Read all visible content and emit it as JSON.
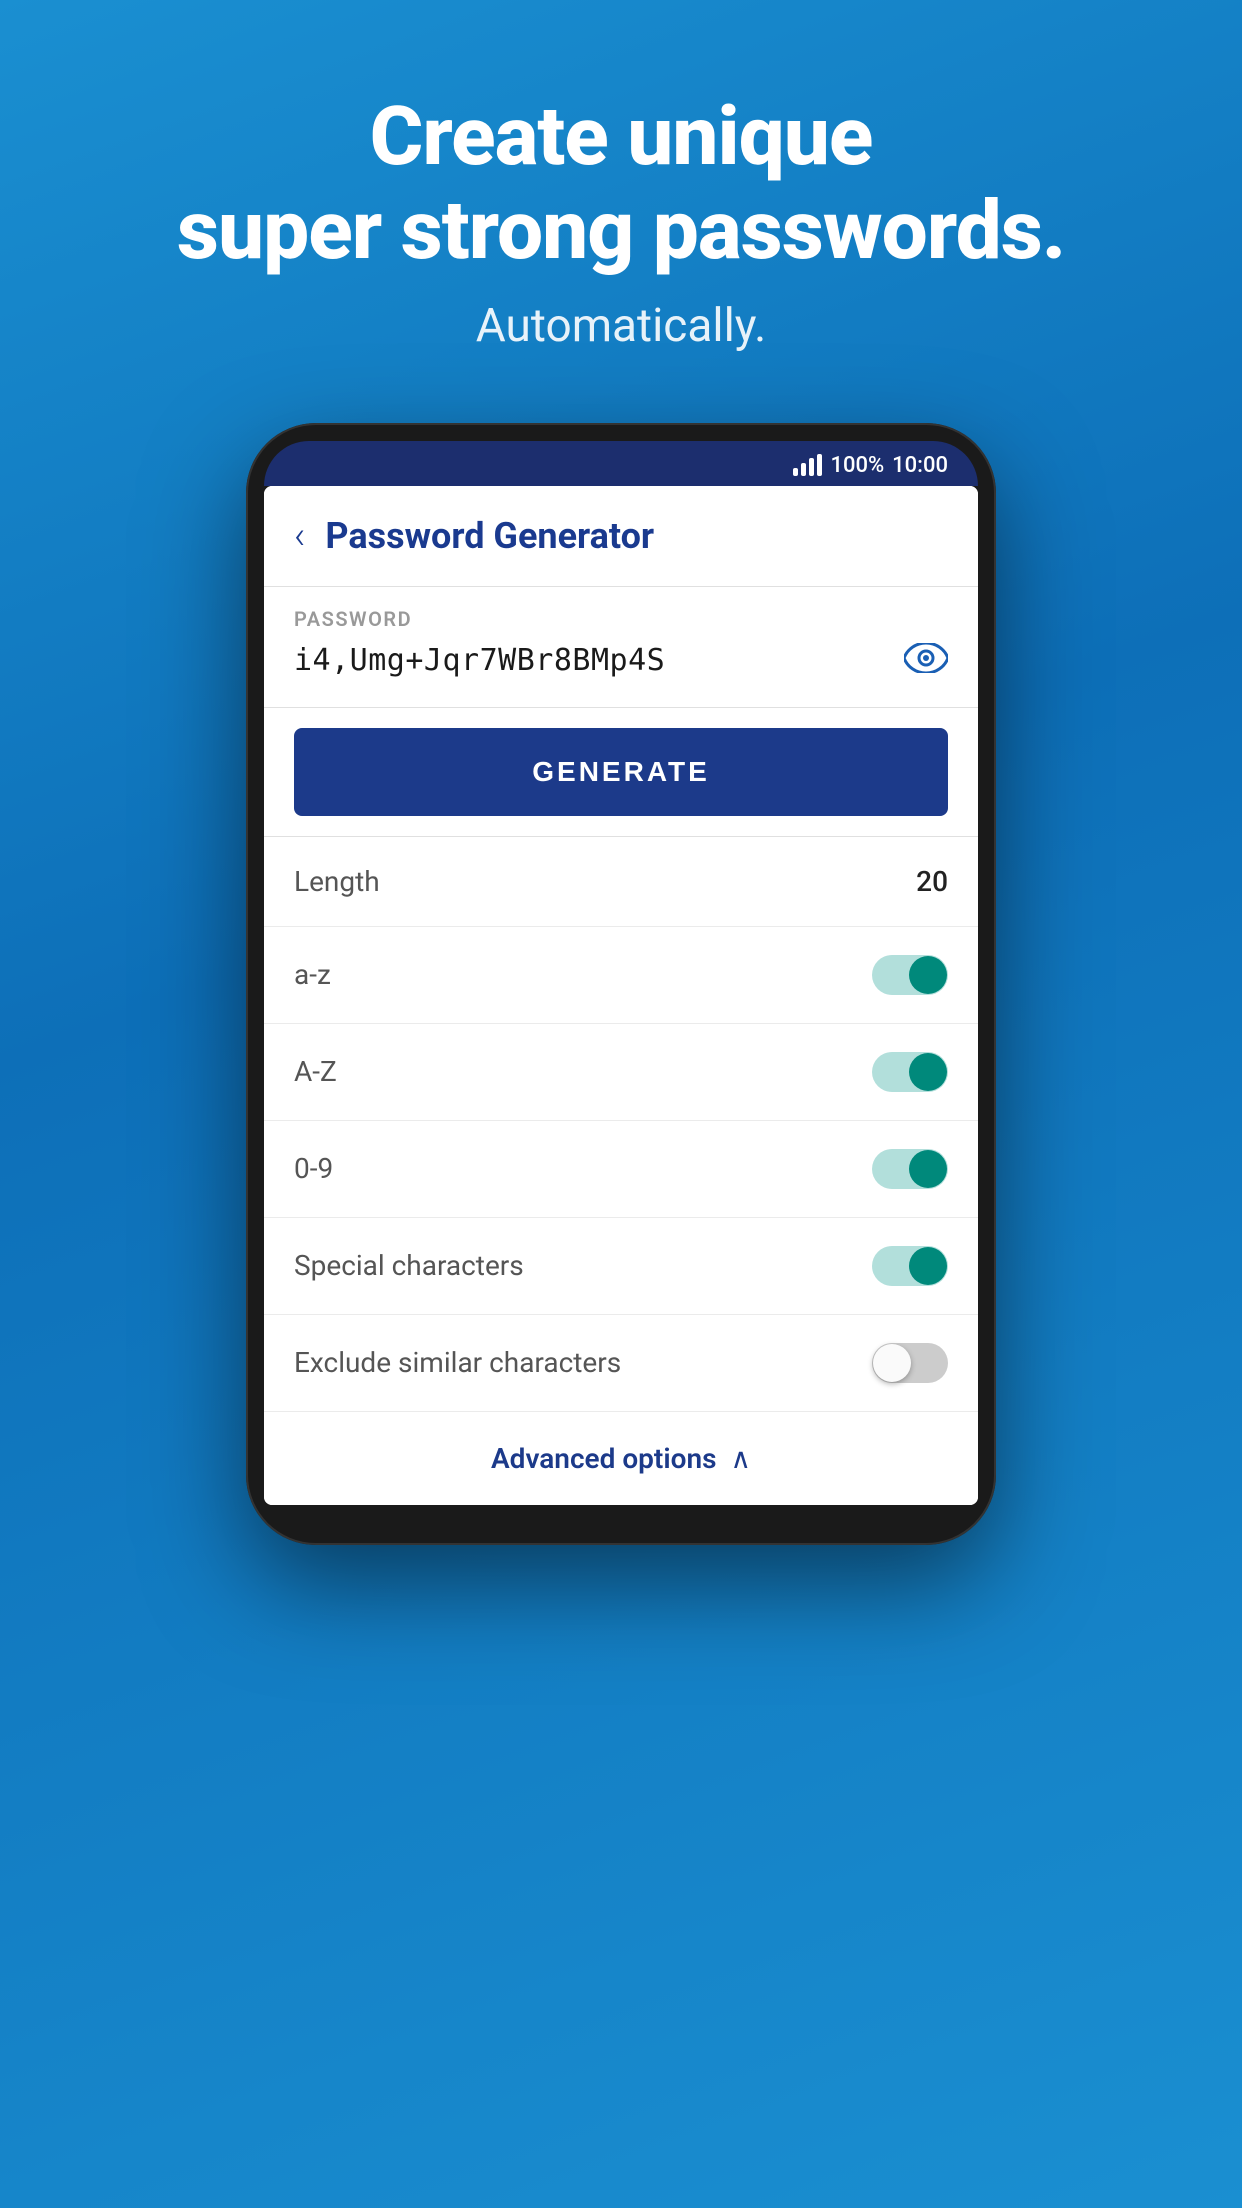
{
  "hero": {
    "title_line1": "Create unique",
    "title_line2": "super strong passwords.",
    "subtitle": "Automatically."
  },
  "status_bar": {
    "signal": "signal",
    "battery": "100%",
    "time": "10:00"
  },
  "app_bar": {
    "title": "Password Generator",
    "back_label": "‹"
  },
  "password_section": {
    "label": "PASSWORD",
    "value": "i4,Umg+Jqr7WBr8BMp4S"
  },
  "generate_button": {
    "label": "GENERATE"
  },
  "settings": {
    "length_label": "Length",
    "length_value": "20",
    "az_label": "a-z",
    "az_on": true,
    "AZ_label": "A-Z",
    "AZ_on": true,
    "zero9_label": "0-9",
    "zero9_on": true,
    "special_label": "Special characters",
    "special_on": true,
    "exclude_label": "Exclude similar characters",
    "exclude_on": false
  },
  "advanced": {
    "label": "Advanced options",
    "chevron": "∧"
  }
}
